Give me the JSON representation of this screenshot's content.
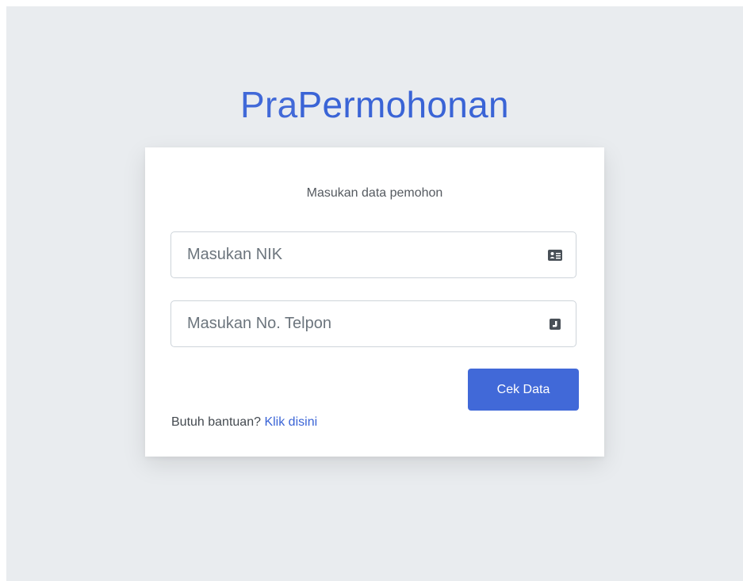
{
  "brand": {
    "light": "Pra",
    "bold": "Permohonan"
  },
  "form": {
    "title": "Masukan data pemohon",
    "nik_placeholder": "Masukan NIK",
    "nik_icon": "id-card-icon",
    "phone_placeholder": "Masukan No. Telpon",
    "phone_icon": "phone-square-icon",
    "submit_label": "Cek Data",
    "help_text": "Butuh bantuan?",
    "help_link": "Klik disini"
  },
  "colors": {
    "background": "#e9ecef",
    "accent": "#4169d8",
    "card": "#ffffff"
  }
}
